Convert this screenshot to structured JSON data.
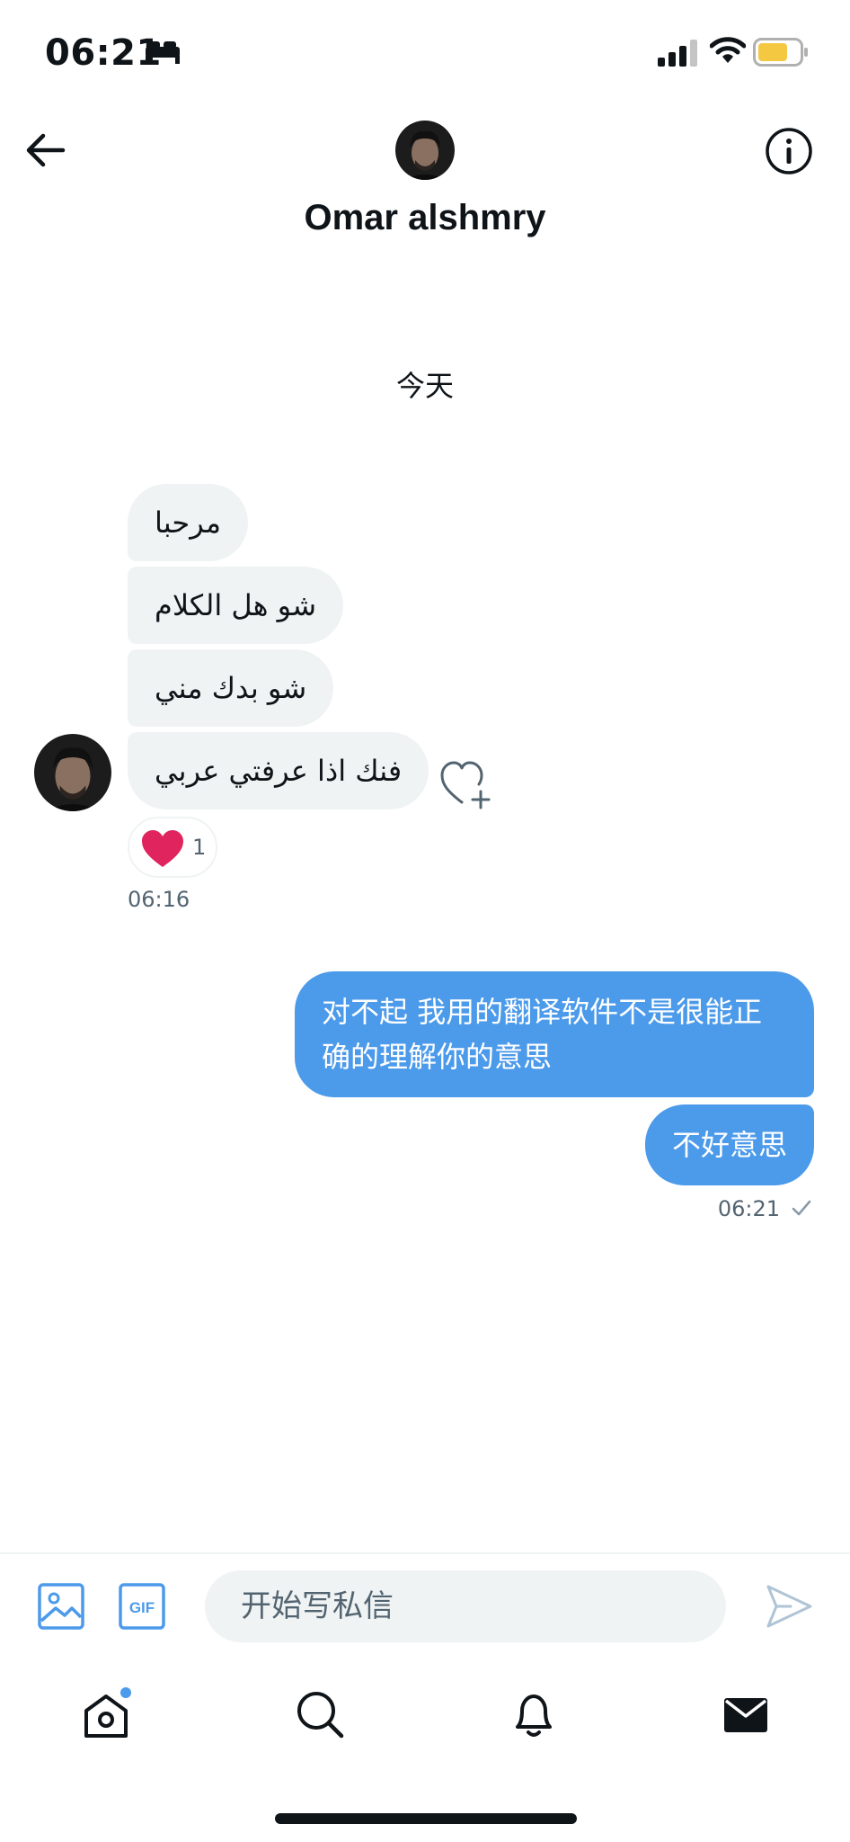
{
  "status_bar": {
    "time": "06:21"
  },
  "header": {
    "contact_name": "Omar alshmry"
  },
  "conversation": {
    "date_separator": "今天",
    "incoming": {
      "messages": [
        "مرحبا",
        "شو هل الكلام",
        "شو بدك مني",
        "فنك اذا عرفتي عربي"
      ],
      "reaction_count": "1",
      "timestamp": "06:16"
    },
    "outgoing": {
      "messages": [
        "对不起 我用的翻译软件不是很能正确的理解你的意思",
        "不好意思"
      ],
      "timestamp": "06:21"
    }
  },
  "composer": {
    "placeholder": "开始写私信",
    "gif_label": "GIF"
  },
  "colors": {
    "accent": "#4c9aea",
    "bubble_incoming": "#eff3f4",
    "heart": "#e0245e"
  },
  "icons": {
    "status": [
      "bed-icon",
      "signal-icon",
      "wifi-icon",
      "battery-icon"
    ],
    "header": [
      "back-arrow-icon",
      "info-icon"
    ],
    "composer": [
      "image-icon",
      "gif-icon",
      "send-icon"
    ],
    "tabs": [
      "home-icon",
      "search-icon",
      "bell-icon",
      "mail-icon"
    ]
  }
}
